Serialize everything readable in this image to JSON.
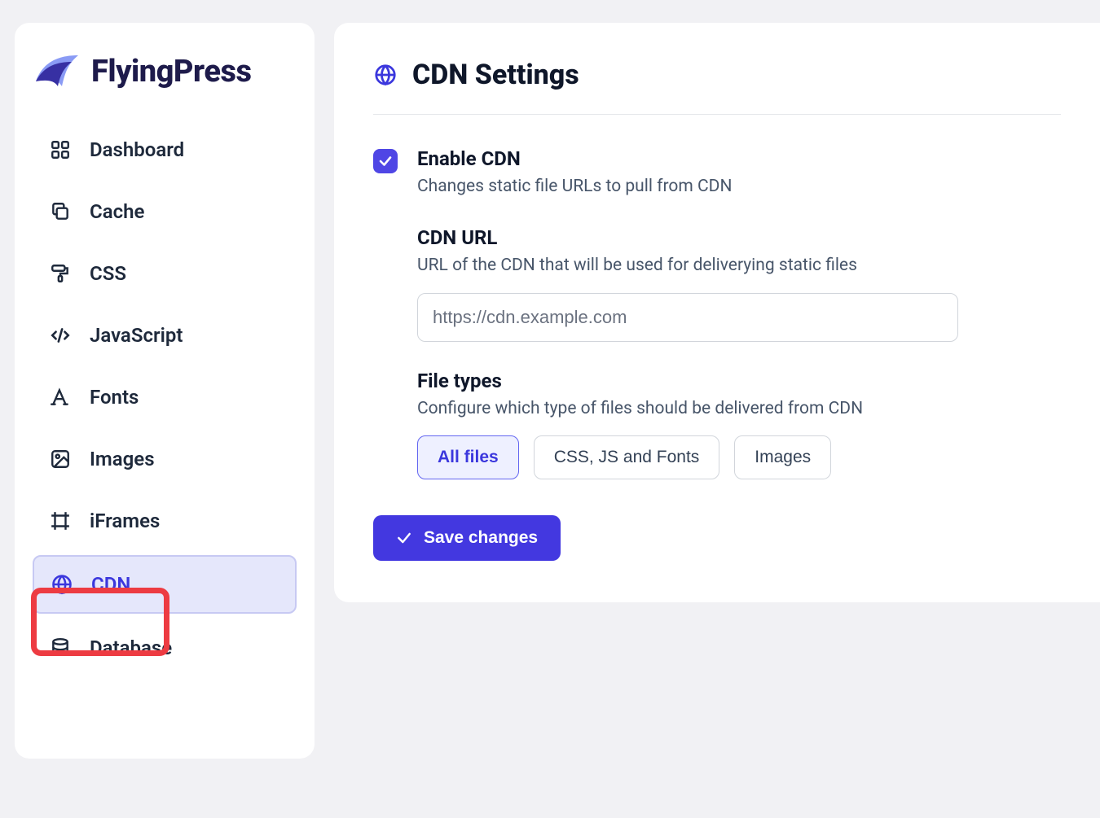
{
  "brand": {
    "name": "FlyingPress"
  },
  "sidebar": {
    "items": [
      {
        "label": "Dashboard"
      },
      {
        "label": "Cache"
      },
      {
        "label": "CSS"
      },
      {
        "label": "JavaScript"
      },
      {
        "label": "Fonts"
      },
      {
        "label": "Images"
      },
      {
        "label": "iFrames"
      },
      {
        "label": "CDN"
      },
      {
        "label": "Database"
      }
    ],
    "active_index": 7
  },
  "page": {
    "title": "CDN Settings",
    "enable": {
      "title": "Enable CDN",
      "desc": "Changes static file URLs to pull from CDN",
      "checked": true
    },
    "cdn_url": {
      "title": "CDN URL",
      "desc": "URL of the CDN that will be used for deliverying static files",
      "placeholder": "https://cdn.example.com",
      "value": ""
    },
    "file_types": {
      "title": "File types",
      "desc": "Configure which type of files should be delivered from CDN",
      "options": [
        "All files",
        "CSS, JS and Fonts",
        "Images"
      ],
      "selected_index": 0
    },
    "save_label": "Save changes"
  }
}
